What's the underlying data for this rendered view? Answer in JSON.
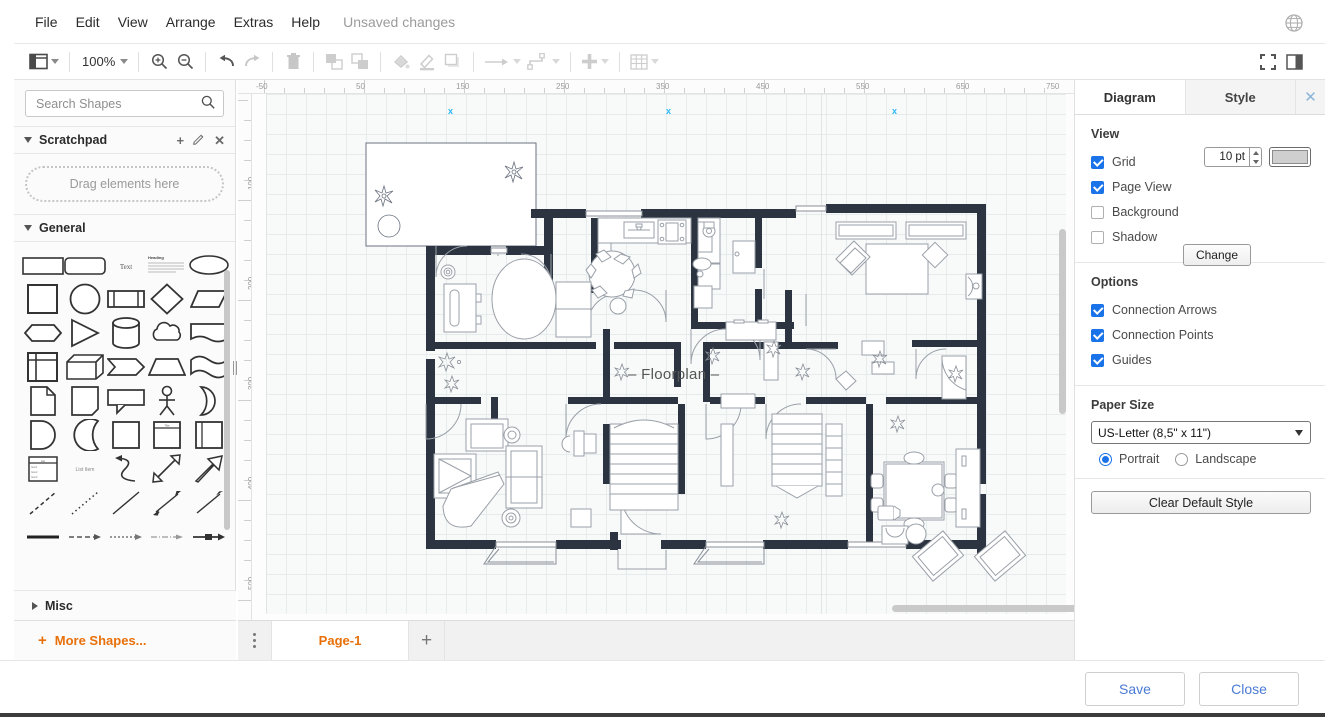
{
  "app": {
    "status_text": "Unsaved changes",
    "accent_orange": "#E8700A",
    "accent_blue": "#1a73e8",
    "link_blue": "#4a7bd4"
  },
  "menubar": {
    "items": [
      {
        "label": "File",
        "name": "menu-file"
      },
      {
        "label": "Edit",
        "name": "menu-edit"
      },
      {
        "label": "View",
        "name": "menu-view"
      },
      {
        "label": "Arrange",
        "name": "menu-arrange"
      },
      {
        "label": "Extras",
        "name": "menu-extras"
      },
      {
        "label": "Help",
        "name": "menu-help"
      }
    ],
    "language_icon": "globe-icon"
  },
  "toolbar": {
    "view_icon": "layout-panels-icon",
    "zoom_level": "100%",
    "zoom_in_icon": "zoom-in-icon",
    "zoom_out_icon": "zoom-out-icon",
    "undo_icon": "undo-icon",
    "redo_icon": "redo-icon",
    "delete_icon": "trash-icon",
    "to_front_icon": "bring-to-front-icon",
    "to_back_icon": "send-to-back-icon",
    "fill_icon": "fill-color-icon",
    "line_icon": "line-color-icon",
    "shadow_icon": "shadow-icon",
    "connection_icon": "connection-arrow-icon",
    "waypoints_icon": "waypoints-icon",
    "insert_icon": "insert-plus-icon",
    "table_icon": "table-grid-icon",
    "fullscreen_icon": "fullscreen-icon",
    "format_panel_icon": "toggle-format-panel-icon"
  },
  "shapes_panel": {
    "search": {
      "placeholder": "Search Shapes",
      "value": "",
      "icon": "search-icon"
    },
    "scratchpad": {
      "title": "Scratchpad",
      "dropzone_text": "Drag elements here",
      "add_icon": "plus-icon",
      "edit_icon": "pencil-icon",
      "close_icon": "close-icon"
    },
    "general": {
      "title": "General"
    },
    "misc": {
      "title": "Misc"
    },
    "more_shapes": {
      "label": "More Shapes...",
      "icon": "plus-icon"
    },
    "shape_names": [
      "rectangle",
      "rounded-rectangle",
      "text",
      "heading-textblock",
      "ellipse",
      "square",
      "circle",
      "process",
      "rhombus",
      "parallelogram",
      "hexagon",
      "triangle",
      "cylinder",
      "cloud",
      "document",
      "internal-storage",
      "cube",
      "step",
      "trapezoid",
      "tape",
      "note",
      "card",
      "callout",
      "actor",
      "half-circle",
      "d-shape",
      "pac-man",
      "container-box",
      "container-titled",
      "container-vertical",
      "list-box",
      "list-item",
      "curve-arrow",
      "bidirectional-arrow",
      "block-arrow",
      "dashed-line",
      "dotted-line",
      "plain-line",
      "double-arrow",
      "single-arrow",
      "thick-line",
      "dashed-arrow",
      "dotted-arrow",
      "dash-dot-arrow",
      "labeled-arrow"
    ]
  },
  "canvas": {
    "ruler_h_labels": [
      "-50",
      "50",
      "150",
      "250",
      "350",
      "450",
      "550",
      "650",
      "750"
    ],
    "ruler_v_labels": [
      "100",
      "200",
      "300",
      "400",
      "500"
    ],
    "diagram_title": "– Floorplan –",
    "guide_marker": "x"
  },
  "tabbar": {
    "menu_icon": "page-menu-icon",
    "pages": [
      {
        "label": "Page-1",
        "active": true
      }
    ],
    "add_icon": "add-page-icon"
  },
  "format_panel": {
    "tabs": [
      {
        "label": "Diagram",
        "active": true
      },
      {
        "label": "Style",
        "active": false
      }
    ],
    "close_icon": "close-icon",
    "view": {
      "title": "View",
      "grid": {
        "label": "Grid",
        "checked": true
      },
      "grid_size": "10 pt",
      "grid_color": "#cfcfcf",
      "page_view": {
        "label": "Page View",
        "checked": true
      },
      "background": {
        "label": "Background",
        "checked": false,
        "button": "Change"
      },
      "shadow": {
        "label": "Shadow",
        "checked": false
      }
    },
    "options": {
      "title": "Options",
      "connection_arrows": {
        "label": "Connection Arrows",
        "checked": true
      },
      "connection_points": {
        "label": "Connection Points",
        "checked": true
      },
      "guides": {
        "label": "Guides",
        "checked": true
      }
    },
    "paper": {
      "title": "Paper Size",
      "selected": "US-Letter (8,5\" x 11\")",
      "options": [
        "US-Letter (8,5\" x 11\")"
      ],
      "orientation": [
        {
          "label": "Portrait",
          "selected": true
        },
        {
          "label": "Landscape",
          "selected": false
        }
      ]
    },
    "clear_default_style": "Clear Default Style"
  },
  "footer": {
    "save": "Save",
    "close": "Close"
  }
}
